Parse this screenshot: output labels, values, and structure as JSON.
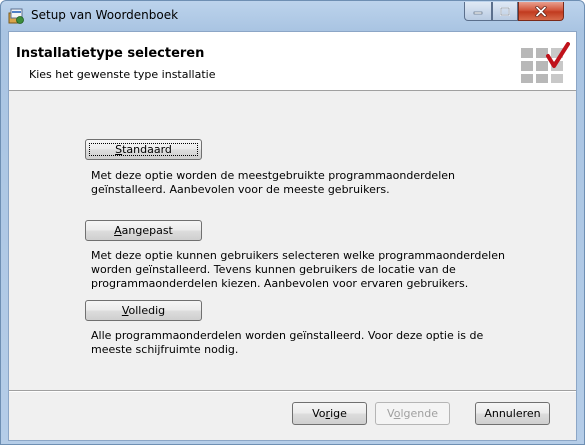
{
  "window": {
    "title": "Setup van Woordenboek",
    "icons": {
      "app": "installer-icon",
      "minimize": "minimize-icon",
      "maximize": "maximize-icon",
      "close": "close-icon"
    }
  },
  "header": {
    "title": "Installatietype selecteren",
    "subtitle": "Kies het gewenste type installatie",
    "logo_icon": "checkmark-grid-logo"
  },
  "options": [
    {
      "label_pre": "",
      "label_accel": "S",
      "label_post": "tandaard",
      "description_lines": [
        "Met deze optie worden de meestgebruikte programmaonderdelen",
        "geïnstalleerd. Aanbevolen voor de meeste gebruikers."
      ]
    },
    {
      "label_pre": "",
      "label_accel": "A",
      "label_post": "angepast",
      "description_lines": [
        "Met deze optie kunnen gebruikers selecteren welke programmaonderdelen",
        "worden geïnstalleerd. Tevens kunnen gebruikers de locatie van de",
        "programmaonderdelen kiezen. Aanbevolen voor ervaren gebruikers."
      ]
    },
    {
      "label_pre": "",
      "label_accel": "V",
      "label_post": "olledig",
      "description_lines": [
        "Alle programmaonderdelen worden geïnstalleerd. Voor deze optie is de",
        "meeste schijfruimte nodig."
      ]
    }
  ],
  "footer": {
    "back": {
      "pre": "Vo",
      "accel": "r",
      "post": "ige"
    },
    "next": {
      "pre": "V",
      "accel": "o",
      "post": "lgende"
    },
    "cancel": {
      "label": "Annuleren"
    }
  },
  "colors": {
    "close_button": "#c94a2e",
    "logo_check": "#c0121b",
    "titlebar": "#b5cde8"
  }
}
